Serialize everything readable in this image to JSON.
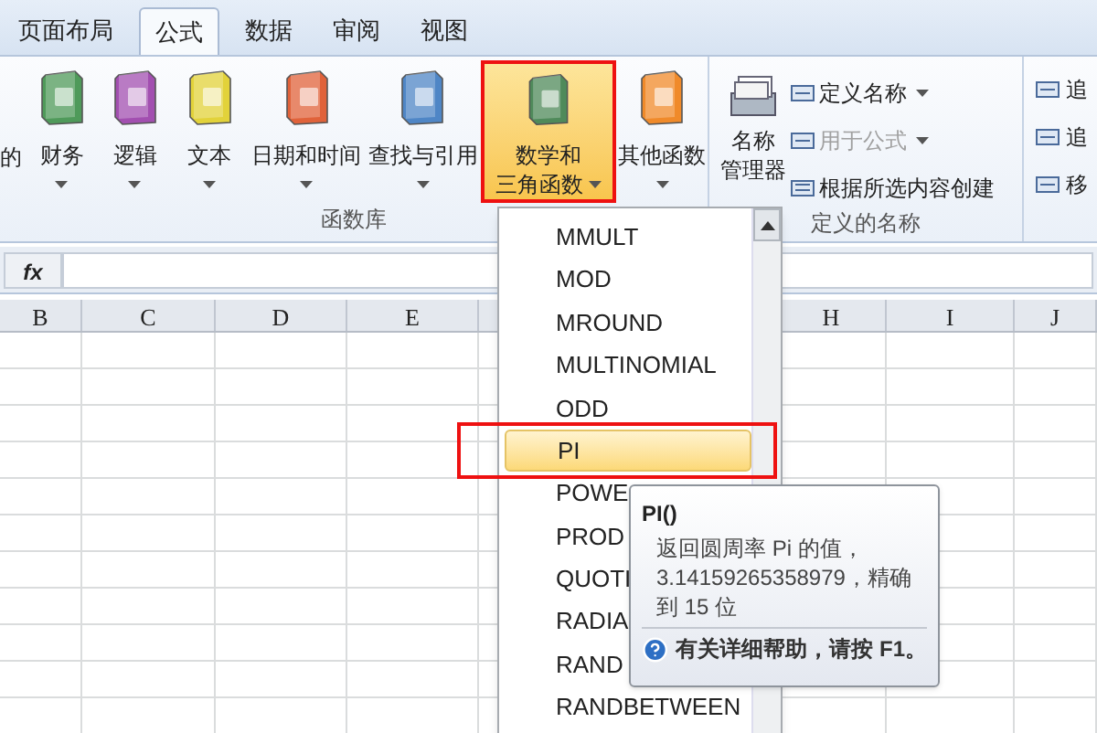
{
  "tabs": [
    {
      "label": "页面布局",
      "selected": false
    },
    {
      "label": "公式",
      "selected": true
    },
    {
      "label": "数据",
      "selected": false
    },
    {
      "label": "审阅",
      "selected": false
    },
    {
      "label": "视图",
      "selected": false
    }
  ],
  "ribbon": {
    "cut_label": "的",
    "function_library": {
      "buttons": [
        {
          "lines": [
            "财务"
          ],
          "highlighted": false,
          "dropdown": true
        },
        {
          "lines": [
            "逻辑"
          ],
          "highlighted": false,
          "dropdown": true
        },
        {
          "lines": [
            "文本"
          ],
          "highlighted": false,
          "dropdown": true
        },
        {
          "lines": [
            "日期和时间"
          ],
          "highlighted": false,
          "dropdown": true
        },
        {
          "lines": [
            "查找与引用"
          ],
          "highlighted": false,
          "dropdown": true
        },
        {
          "lines": [
            "数学和",
            "三角函数"
          ],
          "highlighted": true,
          "dropdown": true
        },
        {
          "lines": [
            "其他函数"
          ],
          "highlighted": false,
          "dropdown": true
        }
      ],
      "group_label": "函数库"
    },
    "defined_names": {
      "name_manager": [
        "名称",
        "管理器"
      ],
      "commands": [
        {
          "label": "定义名称",
          "disabled": false,
          "dropdown": true
        },
        {
          "label": "用于公式",
          "disabled": true,
          "dropdown": true
        },
        {
          "label": "根据所选内容创建",
          "disabled": false,
          "dropdown": false
        }
      ],
      "group_label": "定义的名称"
    },
    "auditing": {
      "commands": [
        "追",
        "追",
        "移"
      ]
    }
  },
  "formula_bar": {
    "fx": "fx"
  },
  "columns": [
    "B",
    "C",
    "D",
    "E",
    "H",
    "I",
    "J"
  ],
  "function_menu": {
    "items": [
      {
        "label": "MMULT",
        "selected": false,
        "highlighted": false
      },
      {
        "label": "MOD",
        "selected": false,
        "highlighted": false
      },
      {
        "label": "MROUND",
        "selected": false,
        "highlighted": false
      },
      {
        "label": "MULTINOMIAL",
        "selected": false,
        "highlighted": false
      },
      {
        "label": "ODD",
        "selected": false,
        "highlighted": false
      },
      {
        "label": "PI",
        "selected": true,
        "highlighted": true
      },
      {
        "label": "POWE",
        "selected": false,
        "highlighted": false
      },
      {
        "label": "PROD",
        "selected": false,
        "highlighted": false
      },
      {
        "label": "QUOTI",
        "selected": false,
        "highlighted": false
      },
      {
        "label": "RADIA",
        "selected": false,
        "highlighted": false
      },
      {
        "label": "RAND",
        "selected": false,
        "highlighted": false
      },
      {
        "label": "RANDBETWEEN",
        "selected": false,
        "highlighted": false
      }
    ]
  },
  "tooltip": {
    "title": "PI()",
    "lines": [
      "返回圆周率 Pi 的值，",
      "3.14159265358979，精确",
      "到 15 位"
    ],
    "help": "有关详细帮助，请按 F1。"
  }
}
